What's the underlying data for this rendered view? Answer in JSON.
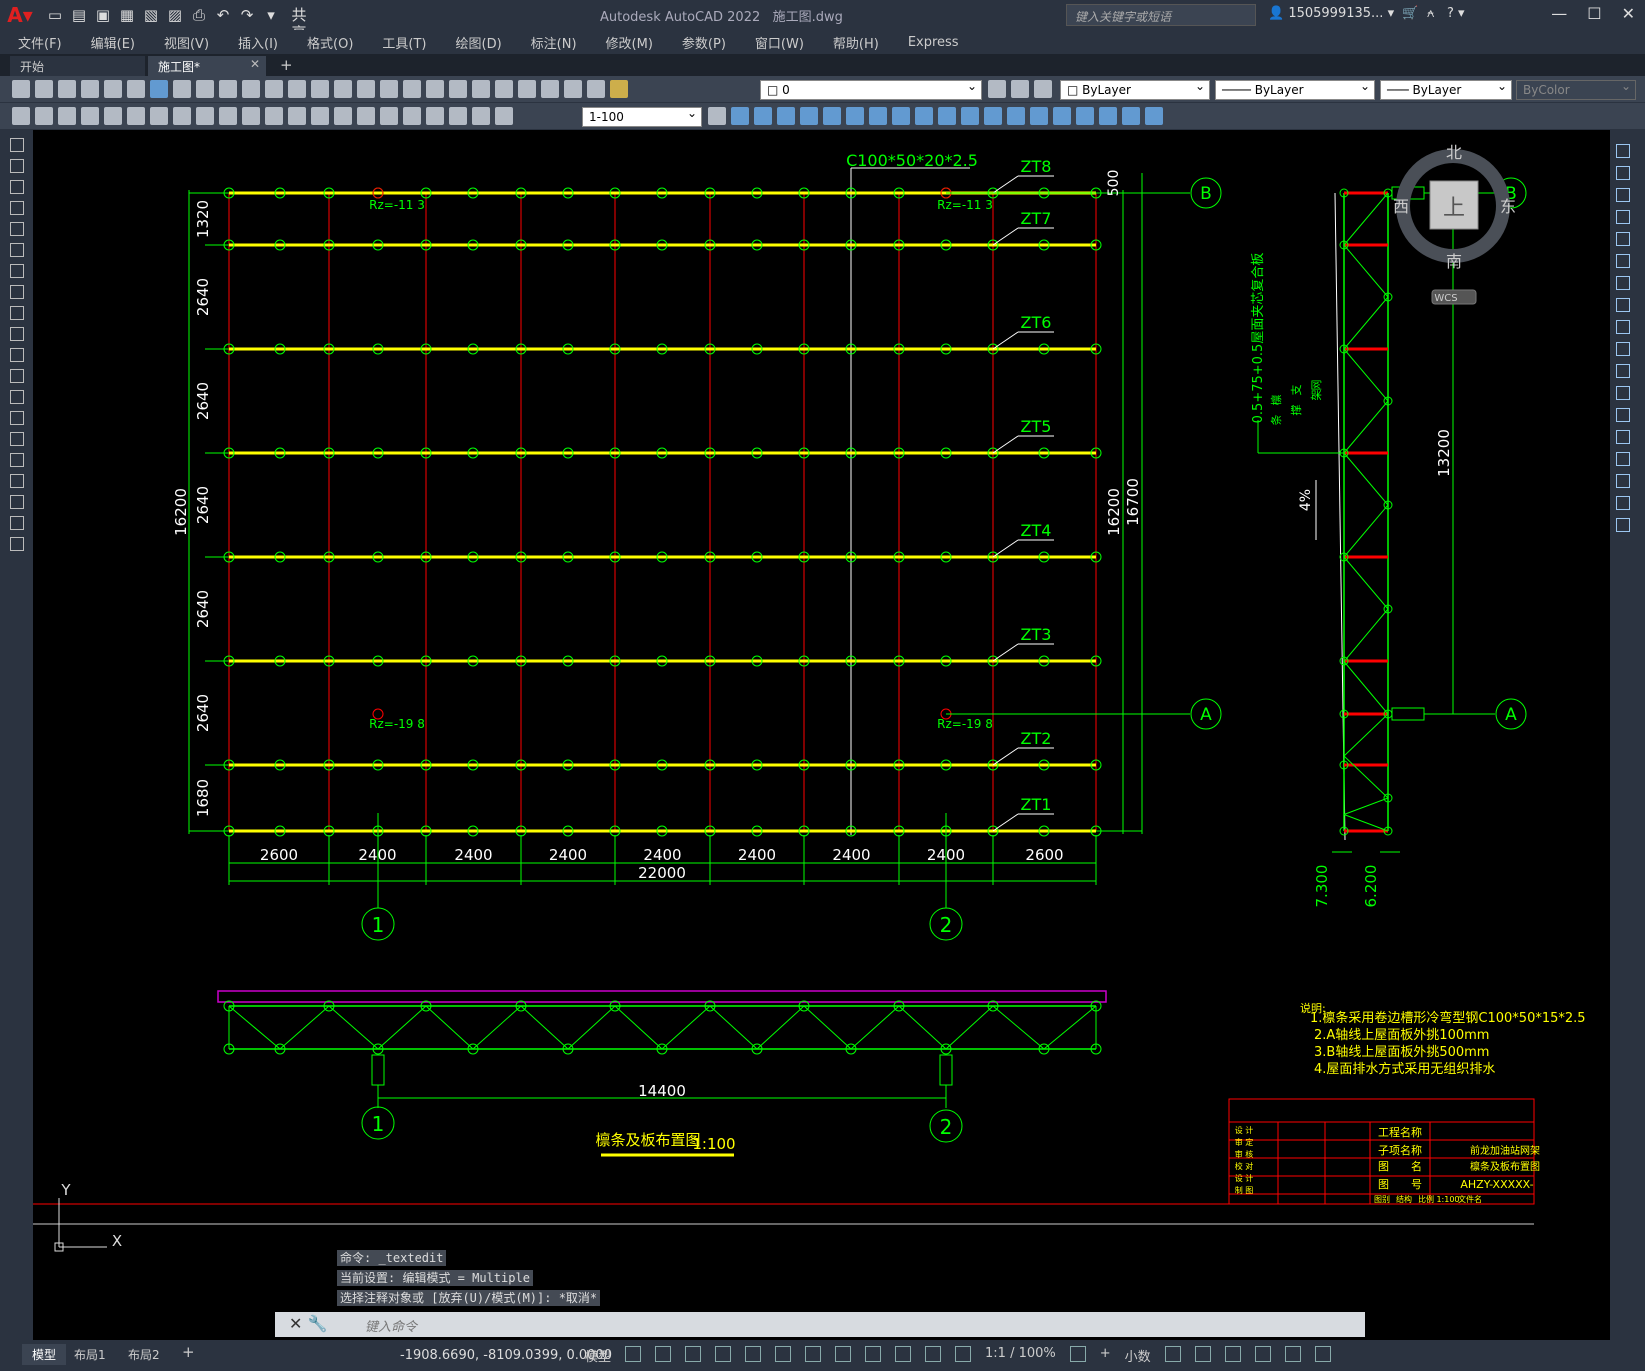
{
  "app": {
    "title": "Autodesk AutoCAD 2022",
    "file": "施工图.dwg",
    "share": "共享",
    "search_placeholder": "键入关键字或短语",
    "user": "1505999135..."
  },
  "menu": [
    "文件(F)",
    "编辑(E)",
    "视图(V)",
    "插入(I)",
    "格式(O)",
    "工具(T)",
    "绘图(D)",
    "标注(N)",
    "修改(M)",
    "参数(P)",
    "窗口(W)",
    "帮助(H)",
    "Express"
  ],
  "tabs": [
    {
      "label": "开始"
    },
    {
      "label": "施工图*"
    }
  ],
  "toolbar": {
    "layer": "0",
    "color": "ByLayer",
    "linetype": "ByLayer",
    "lineweight": "ByLayer",
    "plotstyle": "ByColor",
    "scale": "1-100"
  },
  "colors": {
    "purlin": "#ffff00",
    "line": "#00ff00",
    "rafter": "#ff0000",
    "white": "#ffffff",
    "magenta": "#cc00cc"
  },
  "drawing": {
    "profile": "C100*50*20*2.5",
    "purlins": [
      "ZT8",
      "ZT7",
      "ZT6",
      "ZT5",
      "ZT4",
      "ZT3",
      "ZT2",
      "ZT1"
    ],
    "rz_top": "Rz=-11 3",
    "rz_bot": "Rz=-19 8",
    "left_dims": [
      "1320",
      "2640",
      "2640",
      "2640",
      "2640",
      "2640",
      "1680"
    ],
    "left_total": "16200",
    "right_top": "500",
    "right_dim1": "16200",
    "right_dim2": "16700",
    "bottom_dims": [
      "2600",
      "2400",
      "2400",
      "2400",
      "2400",
      "2400",
      "2400",
      "2400",
      "2600"
    ],
    "bottom_total": "22000",
    "axis_b": "B",
    "axis_a": "A",
    "axis_1": "1",
    "axis_2": "2",
    "truss_span": "14400",
    "section_text": "0.5+75+0.5屋面夹芯复合板",
    "section_labels": [
      "檩",
      "条",
      "支",
      "撑",
      "网",
      "架"
    ],
    "slope": "4%",
    "elev1": "7.300",
    "elev2": "6.200",
    "height_dim": "13200",
    "title_cn": "檩条及板布置图",
    "title_scale": "1:100"
  },
  "notes": {
    "header": "说明:",
    "lines": [
      "1.檩条采用卷边槽形冷弯型钢C100*50*15*2.5",
      "2.A轴线上屋面板外挑100mm",
      "3.B轴线上屋面板外挑500mm",
      "4.屋面排水方式采用无组织排水"
    ]
  },
  "titleblock": {
    "rows": [
      [
        "设",
        "计"
      ],
      [
        "审",
        "定"
      ],
      [
        "审",
        "核"
      ],
      [
        "校",
        "对"
      ],
      [
        "设",
        "计"
      ],
      [
        "制",
        "图"
      ]
    ],
    "project_label": "工程名称",
    "sub_label": "子项名称",
    "drawing_label": "图　　名",
    "number_label": "图　　号",
    "project_value": "前龙加油站网架",
    "drawing_value": "檩条及板布置图",
    "number_value": "AHZY-XXXXX-",
    "footer": [
      "图别",
      "结构",
      "比例",
      "1:100",
      "文件名"
    ]
  },
  "compass": {
    "n": "北",
    "s": "南",
    "e": "东",
    "w": "西",
    "center": "上",
    "wcs": "WCS"
  },
  "ucs": {
    "y": "Y",
    "x": "X"
  },
  "command": {
    "line1": "命令: _textedit",
    "line2": "当前设置: 编辑模式 = Multiple",
    "line3": "选择注释对象或 [放弃(U)/模式(M)]: *取消*",
    "placeholder": "键入命令"
  },
  "status": {
    "tabs": [
      "模型",
      "布局1",
      "布局2"
    ],
    "coords": "-1908.6690, -8109.0399, 0.0000",
    "mode": "模型",
    "scale": "1:1 / 100%",
    "units": "小数"
  }
}
